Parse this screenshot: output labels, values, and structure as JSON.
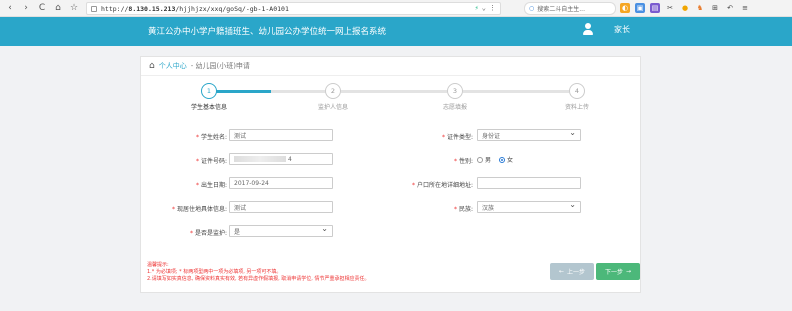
{
  "browser": {
    "url_prefix": "http://",
    "url_host": "8.130.15.213",
    "url_path": "/hjjhjzx/xxq/goSq/-gb-1-A0101",
    "search_placeholder": "搜索二斗自主生...",
    "nav_back": "‹",
    "nav_forward": "›",
    "nav_reload": "C",
    "nav_home": "⌂",
    "nav_star": "☆"
  },
  "header": {
    "title": "黄江公办中小学户籍插班生、幼儿园公办学位统一网上报名系统",
    "user_label": "家长",
    "color": "#2aa6c9"
  },
  "breadcrumb": {
    "link": "个人中心",
    "separator": "-",
    "current": "- 幼儿园(小班)申请"
  },
  "steps": [
    {
      "number": "1",
      "label": "学生基本信息",
      "active": true
    },
    {
      "number": "2",
      "label": "监护人信息",
      "active": false
    },
    {
      "number": "3",
      "label": "志愿填报",
      "active": false
    },
    {
      "number": "4",
      "label": "资料上传",
      "active": false
    }
  ],
  "form": {
    "student_name": {
      "label": "学生姓名:",
      "value": "测试"
    },
    "id_type": {
      "label": "证件类型:",
      "value": "身份证"
    },
    "id_number": {
      "label": "证件号码:",
      "value": "4"
    },
    "gender": {
      "label": "性别:",
      "options": [
        "男",
        "女"
      ],
      "selected": "女"
    },
    "birth_date": {
      "label": "出生日期:",
      "value": "2017-09-24"
    },
    "hukou_address": {
      "label": "户口所在地详细地址:",
      "value": ""
    },
    "current_address": {
      "label": "现居住地具体信息:",
      "value": "测试"
    },
    "ethnicity": {
      "label": "民族:",
      "value": "汉族"
    },
    "is_guardian": {
      "label": "是否是监护:",
      "value": "是"
    }
  },
  "notes": {
    "title": "温馨提示:",
    "line1": "1.* 为必填项; * 标两项型两中一项为必填项, 另一项可不填。",
    "line2": "2.请填写如实真信息, 确保资料真实有效, 若有异虚作假填报, 取消申请学位, 情节严重承担相应责任。"
  },
  "buttons": {
    "prev": "上一步",
    "next": "下一步"
  }
}
